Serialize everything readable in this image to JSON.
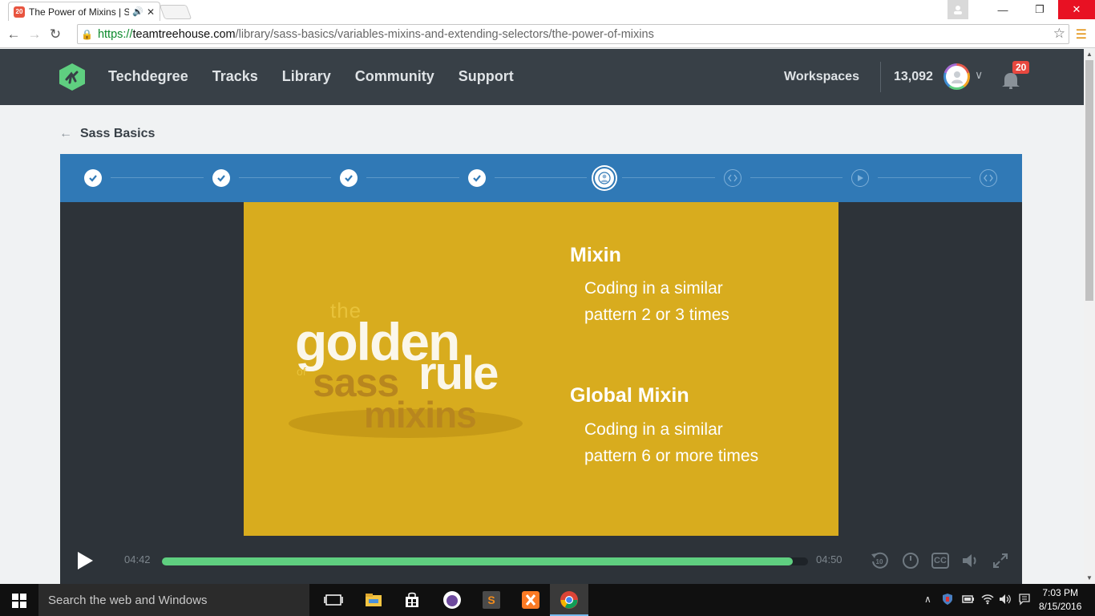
{
  "browser": {
    "tab_title": "The Power of Mixins | S",
    "tab_favicon_text": "20",
    "url_https": "https://",
    "url_host": "teamtreehouse.com",
    "url_path": "/library/sass-basics/variables-mixins-and-extending-selectors/the-power-of-mixins"
  },
  "header": {
    "nav": [
      "Techdegree",
      "Tracks",
      "Library",
      "Community",
      "Support"
    ],
    "workspaces": "Workspaces",
    "points": "13,092",
    "notifications": "20"
  },
  "breadcrumb": {
    "label": "Sass Basics"
  },
  "steps": [
    {
      "status": "done"
    },
    {
      "status": "done"
    },
    {
      "status": "done"
    },
    {
      "status": "done"
    },
    {
      "status": "current"
    },
    {
      "status": "code"
    },
    {
      "status": "video"
    },
    {
      "status": "code"
    }
  ],
  "slide": {
    "logo_the": "the",
    "logo_golden": "golden",
    "logo_of": "of",
    "logo_sass": "sass",
    "logo_rule": "rule",
    "logo_mixins": "mixins",
    "heading1": "Mixin",
    "line1a": "Coding in a similar",
    "line1b": "pattern 2 or 3 times",
    "heading2": "Global Mixin",
    "line2a": "Coding in a similar",
    "line2b": "pattern 6 or more times"
  },
  "player": {
    "current_time": "04:42",
    "duration": "04:50",
    "progress": 0.976,
    "rewind_label": "10",
    "cc_label": "CC"
  },
  "taskbar": {
    "search_placeholder": "Search the web and Windows",
    "time": "7:03 PM",
    "date": "8/15/2016"
  },
  "colors": {
    "header_bg": "#384047",
    "steps_bg": "#3079b6",
    "slide_bg": "#d8ac1e",
    "progress_fill": "#5fcf80",
    "logo_green": "#5fcf80"
  }
}
